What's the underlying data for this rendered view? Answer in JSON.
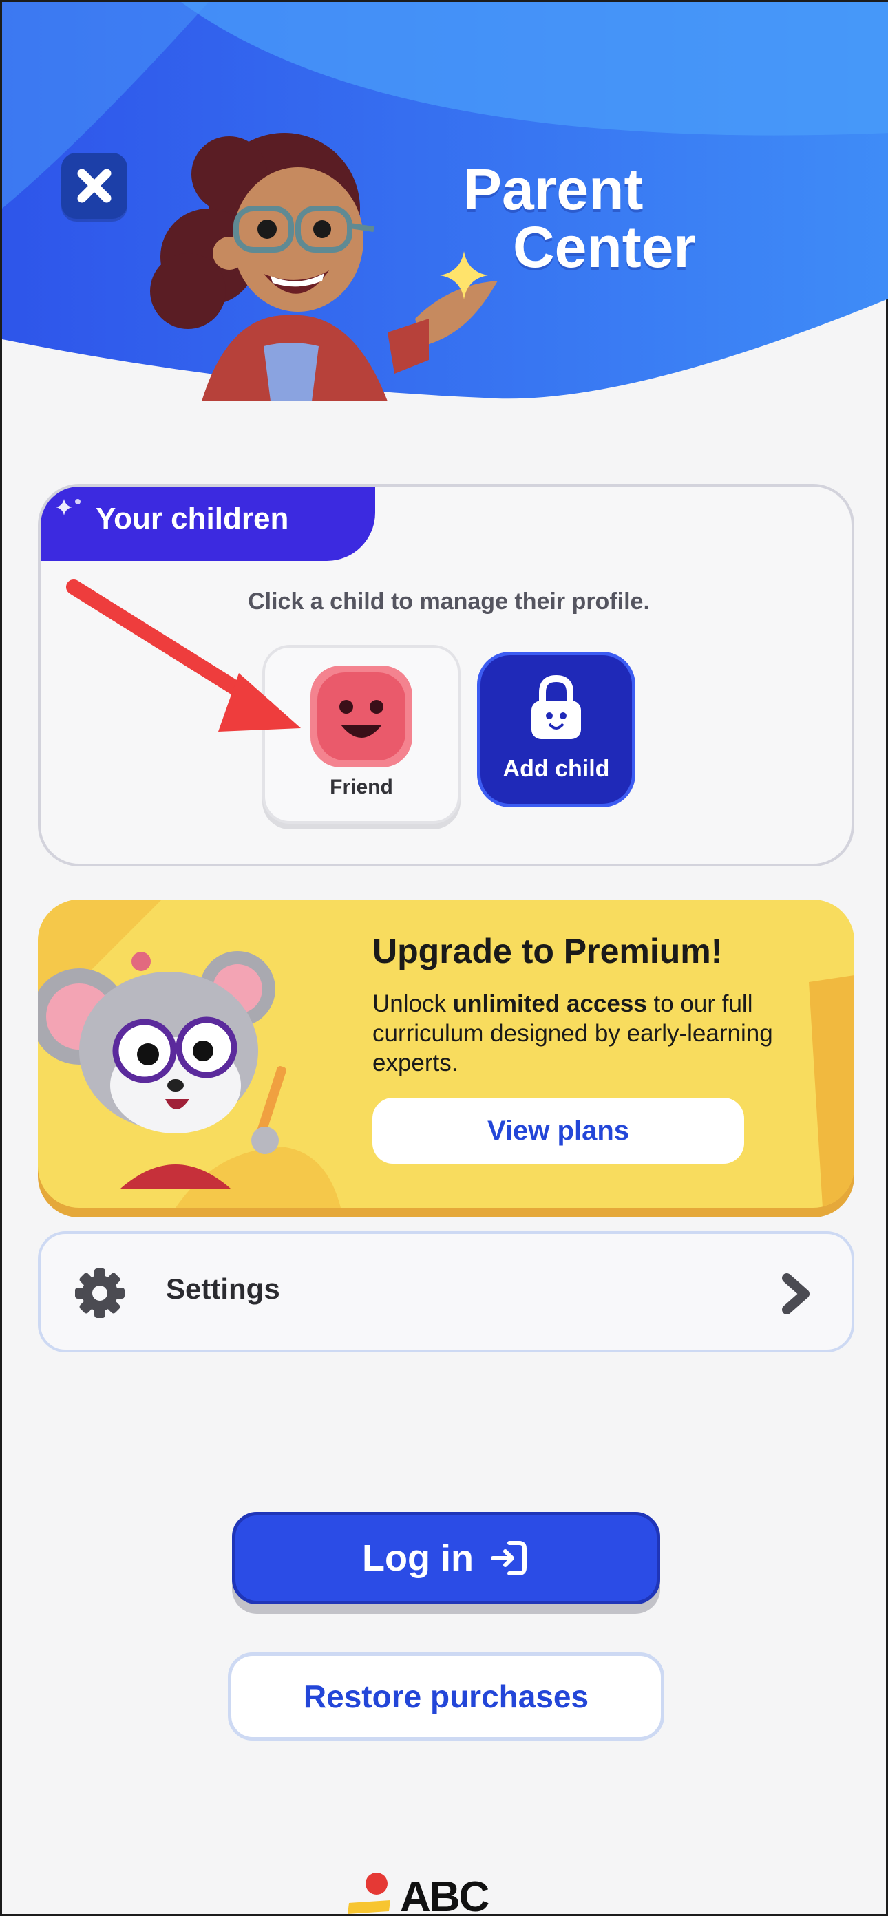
{
  "header": {
    "title_line1": "Parent",
    "title_line2": "Center",
    "close_icon": "close-x-icon"
  },
  "children": {
    "section_label": "Your children",
    "hint": "Click a child to manage their profile.",
    "profiles": [
      {
        "name": "Friend",
        "avatar_color": "#f4838f"
      }
    ],
    "add_child_label": "Add child"
  },
  "premium": {
    "title": "Upgrade to Premium!",
    "desc_pre": "Unlock ",
    "desc_bold": "unlimited access",
    "desc_post": " to our full curriculum designed by early-learning experts.",
    "cta": "View plans"
  },
  "settings": {
    "label": "Settings"
  },
  "actions": {
    "login": "Log in",
    "restore": "Restore purchases"
  },
  "brand": {
    "logo_text": "ABC"
  },
  "colors": {
    "header_blue": "#2d5ef0",
    "accent_purple": "#3c2ae0",
    "primary_blue": "#2b4ce6",
    "premium_yellow": "#f8dc5e",
    "friend_pink": "#f4838f"
  }
}
